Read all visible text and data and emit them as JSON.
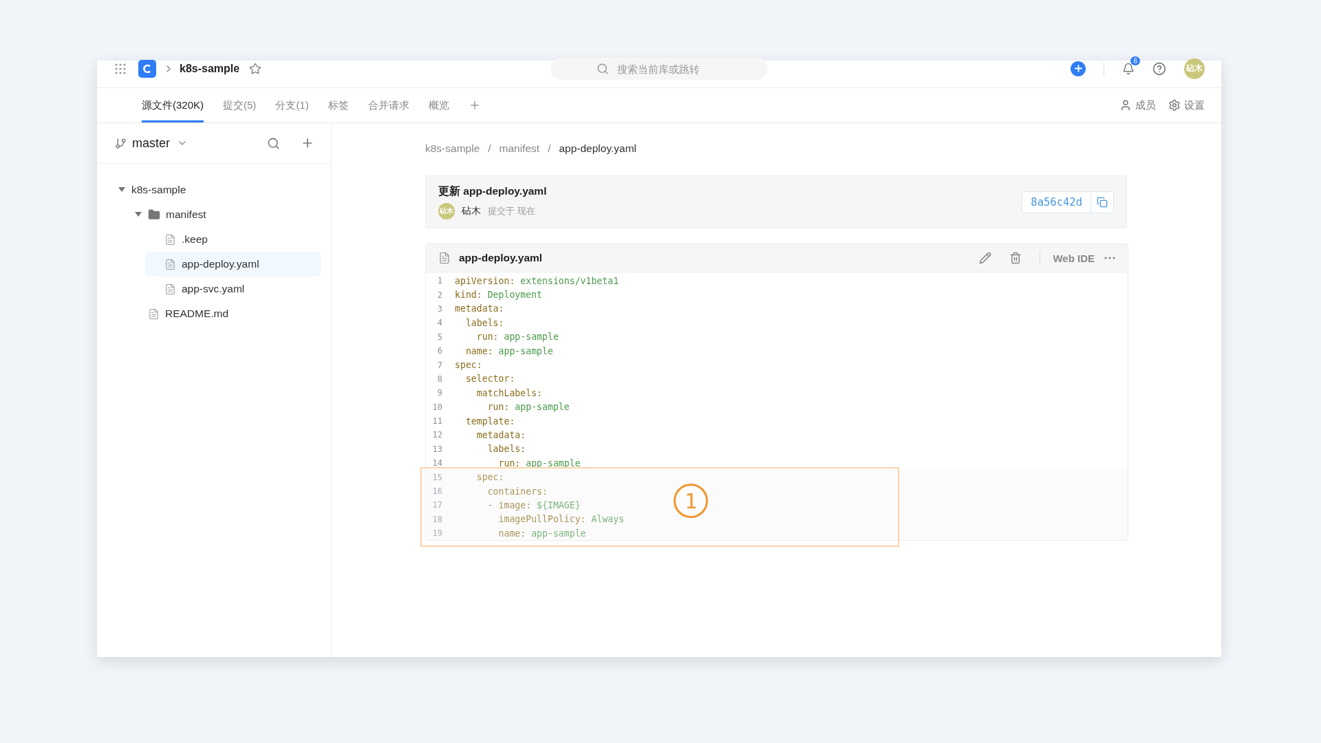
{
  "topbar": {
    "repo": "k8s-sample",
    "search": {
      "placeholder": "搜索当前库或跳转"
    },
    "notifications": "6",
    "avatar": "砧木"
  },
  "tabs": [
    {
      "label": "源文件(320K)",
      "selected": true
    },
    {
      "label": "提交(5)",
      "selected": false
    },
    {
      "label": "分支(1)",
      "selected": false
    },
    {
      "label": "标签",
      "selected": false
    },
    {
      "label": "合并请求",
      "selected": false
    },
    {
      "label": "概览",
      "selected": false
    }
  ],
  "tab_actions": [
    "成员",
    "设置"
  ],
  "sidebar": {
    "branch": "master",
    "tree": [
      {
        "name": "k8s-sample",
        "kind": "folder",
        "expanded": true,
        "selected": false,
        "children": [
          {
            "name": "manifest",
            "kind": "folder",
            "expanded": true,
            "selected": false,
            "children": [
              {
                "name": ".keep",
                "kind": "file",
                "selected": false
              },
              {
                "name": "app-deploy.yaml",
                "kind": "file",
                "selected": true
              },
              {
                "name": "app-svc.yaml",
                "kind": "file",
                "selected": false
              }
            ]
          },
          {
            "name": "README.md",
            "kind": "file",
            "selected": false
          }
        ]
      }
    ]
  },
  "breadcrumb": [
    "k8s-sample",
    "manifest",
    "app-deploy.yaml"
  ],
  "breadcrumb_separator": "/",
  "commit": {
    "message": "更新 app-deploy.yaml",
    "avatar": "砧木",
    "author": "砧木",
    "time": "提交于 现在",
    "hash": "8a56c42d"
  },
  "file": {
    "name": "app-deploy.yaml",
    "webide": "Web IDE",
    "lines": [
      {
        "number": "1",
        "key": "apiVersion:",
        "value": "extensions/v1beta1",
        "dimmed": false
      },
      {
        "number": "2",
        "key": "kind:",
        "value": "Deployment",
        "dimmed": false
      },
      {
        "number": "3",
        "key": "metadata:",
        "dimmed": false
      },
      {
        "number": "4",
        "key": "  labels:",
        "dimmed": false
      },
      {
        "number": "5",
        "key": "    run:",
        "value": "app-sample",
        "dimmed": false
      },
      {
        "number": "6",
        "key": "  name:",
        "value": "app-sample",
        "dimmed": false
      },
      {
        "number": "7",
        "key": "spec:",
        "dimmed": false
      },
      {
        "number": "8",
        "key": "  selector:",
        "dimmed": false
      },
      {
        "number": "9",
        "key": "    matchLabels:",
        "dimmed": false
      },
      {
        "number": "10",
        "key": "      run:",
        "value": "app-sample",
        "dimmed": false
      },
      {
        "number": "11",
        "key": "  template:",
        "dimmed": false
      },
      {
        "number": "12",
        "key": "    metadata:",
        "dimmed": false
      },
      {
        "number": "13",
        "key": "      labels:",
        "dimmed": false
      },
      {
        "number": "14",
        "key": "        run:",
        "value": "app-sample",
        "dimmed": false
      },
      {
        "number": "15",
        "key": "    spec:",
        "dimmed": true
      },
      {
        "number": "16",
        "key": "      containers:",
        "dimmed": true
      },
      {
        "number": "17",
        "key": "      - image:",
        "value": "${IMAGE}",
        "dimmed": true
      },
      {
        "number": "18",
        "key": "        imagePullPolicy:",
        "value": "Always",
        "dimmed": true
      },
      {
        "number": "19",
        "key": "        name:",
        "value": "app-sample",
        "dimmed": true
      }
    ]
  },
  "annotation": {
    "label": "1"
  }
}
